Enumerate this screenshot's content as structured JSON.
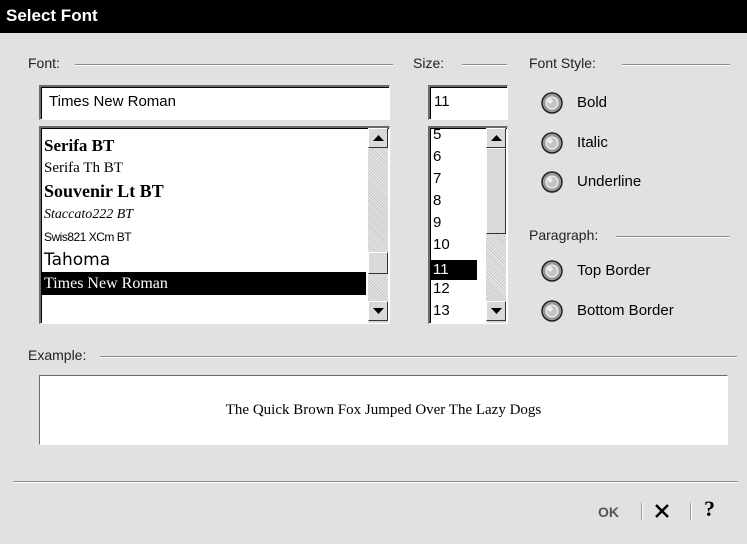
{
  "window": {
    "title": "Select Font"
  },
  "font_section": {
    "label": "Font:",
    "current_value": "Times New Roman",
    "items": [
      {
        "label": "Serifa BT",
        "selected": false
      },
      {
        "label": "Serifa Th BT",
        "selected": false
      },
      {
        "label": "Souvenir Lt BT",
        "selected": false
      },
      {
        "label": "Staccato222 BT",
        "selected": false
      },
      {
        "label": "Swis821 XCm BT",
        "selected": false
      },
      {
        "label": "Tahoma",
        "selected": false
      },
      {
        "label": "Times New Roman",
        "selected": true
      }
    ]
  },
  "size_section": {
    "label": "Size:",
    "current_value": "11",
    "items": [
      "5",
      "6",
      "7",
      "8",
      "9",
      "10",
      "11",
      "12",
      "13"
    ],
    "selected": "11"
  },
  "font_style": {
    "label": "Font Style:",
    "options": [
      {
        "label": "Bold",
        "icon": "radio-button-icon"
      },
      {
        "label": "Italic",
        "icon": "radio-button-icon"
      },
      {
        "label": "Underline",
        "icon": "radio-button-icon"
      }
    ]
  },
  "paragraph": {
    "label": "Paragraph:",
    "options": [
      {
        "label": "Top Border",
        "icon": "radio-button-icon"
      },
      {
        "label": "Bottom Border",
        "icon": "radio-button-icon"
      }
    ]
  },
  "example": {
    "label": "Example:",
    "sample_text": "The Quick Brown Fox Jumped Over The Lazy Dogs"
  },
  "footer": {
    "ok_label": "OK",
    "cancel_icon": "close-icon",
    "help_icon": "help-icon"
  },
  "colors": {
    "dialog_bg": "#e1e1e1",
    "titlebar_bg": "#000000",
    "selection_bg": "#000000"
  }
}
